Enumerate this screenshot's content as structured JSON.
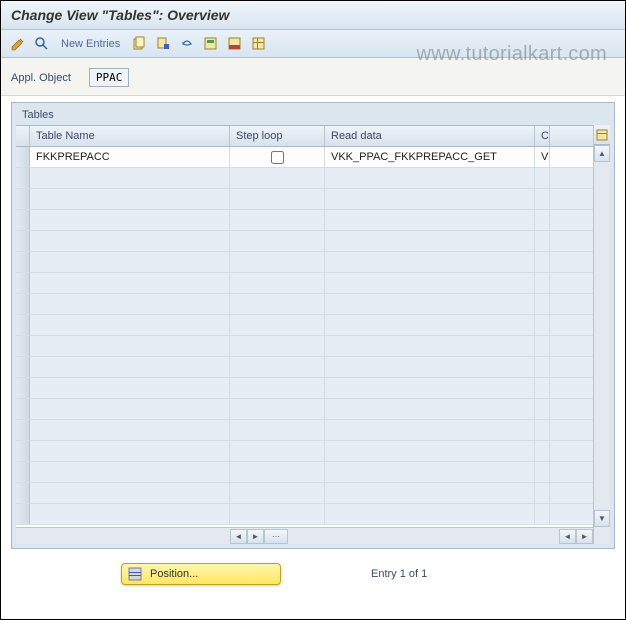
{
  "title": "Change View \"Tables\": Overview",
  "watermark": "www.tutorialkart.com",
  "toolbar": {
    "new_entries": "New Entries"
  },
  "form": {
    "appl_object_label": "Appl. Object",
    "appl_object_value": "PPAC"
  },
  "table": {
    "title": "Tables",
    "columns": {
      "name": "Table Name",
      "loop": "Step loop",
      "read": "Read data",
      "c": "C"
    },
    "row": {
      "name": "FKKPREPACC",
      "loop_checked": false,
      "read": "VKK_PPAC_FKKPREPACC_GET",
      "c": "V"
    }
  },
  "footer": {
    "position_label": "Position...",
    "entry_text": "Entry 1 of 1"
  }
}
